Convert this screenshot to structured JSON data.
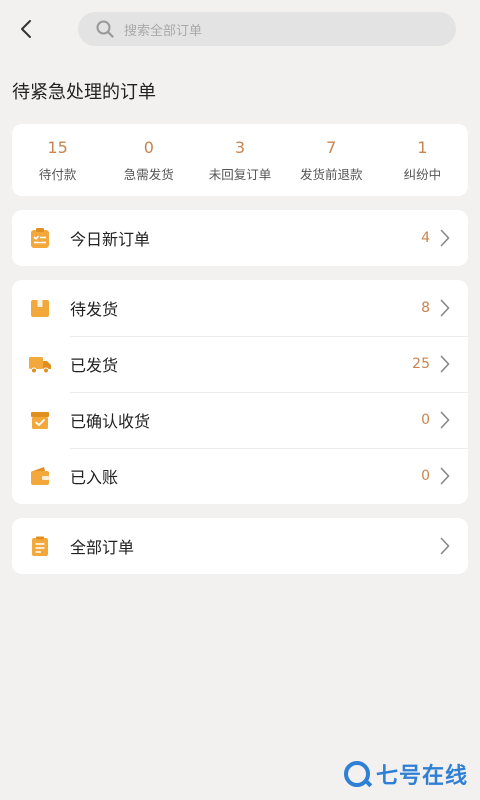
{
  "search": {
    "placeholder": "搜索全部订单"
  },
  "section_title": "待紧急处理的订单",
  "stats": [
    {
      "value": "15",
      "label": "待付款"
    },
    {
      "value": "0",
      "label": "急需发货"
    },
    {
      "value": "3",
      "label": "未回复订单"
    },
    {
      "value": "7",
      "label": "发货前退款"
    },
    {
      "value": "1",
      "label": "纠纷中"
    }
  ],
  "today": {
    "label": "今日新订单",
    "count": "4",
    "icon": "clipboard-check-icon"
  },
  "orders": [
    {
      "label": "待发货",
      "count": "8",
      "icon": "box-icon"
    },
    {
      "label": "已发货",
      "count": "25",
      "icon": "truck-icon"
    },
    {
      "label": "已确认收货",
      "count": "0",
      "icon": "received-box-icon"
    },
    {
      "label": "已入账",
      "count": "0",
      "icon": "wallet-icon"
    }
  ],
  "all_orders": {
    "label": "全部订单",
    "icon": "list-icon"
  },
  "watermark": {
    "text": "七号在线"
  },
  "colors": {
    "accent": "#c8844f",
    "icon": "#f3a83b",
    "background": "#f2f1ef"
  }
}
